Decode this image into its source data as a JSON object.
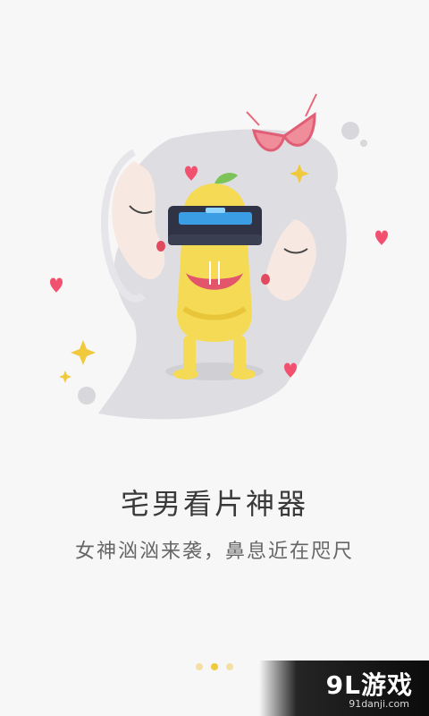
{
  "onboarding": {
    "title": "宅男看片神器",
    "subtitle": "女神汹汹来袭，鼻息近在咫尺",
    "page_indicator": {
      "count": 3,
      "active_index": 1
    },
    "colors": {
      "accent": "#f1c93c",
      "heart": "#f2506f",
      "bg": "#f7f7f7"
    }
  },
  "watermark": {
    "logo": "9L游戏",
    "site": "91danji.com"
  }
}
